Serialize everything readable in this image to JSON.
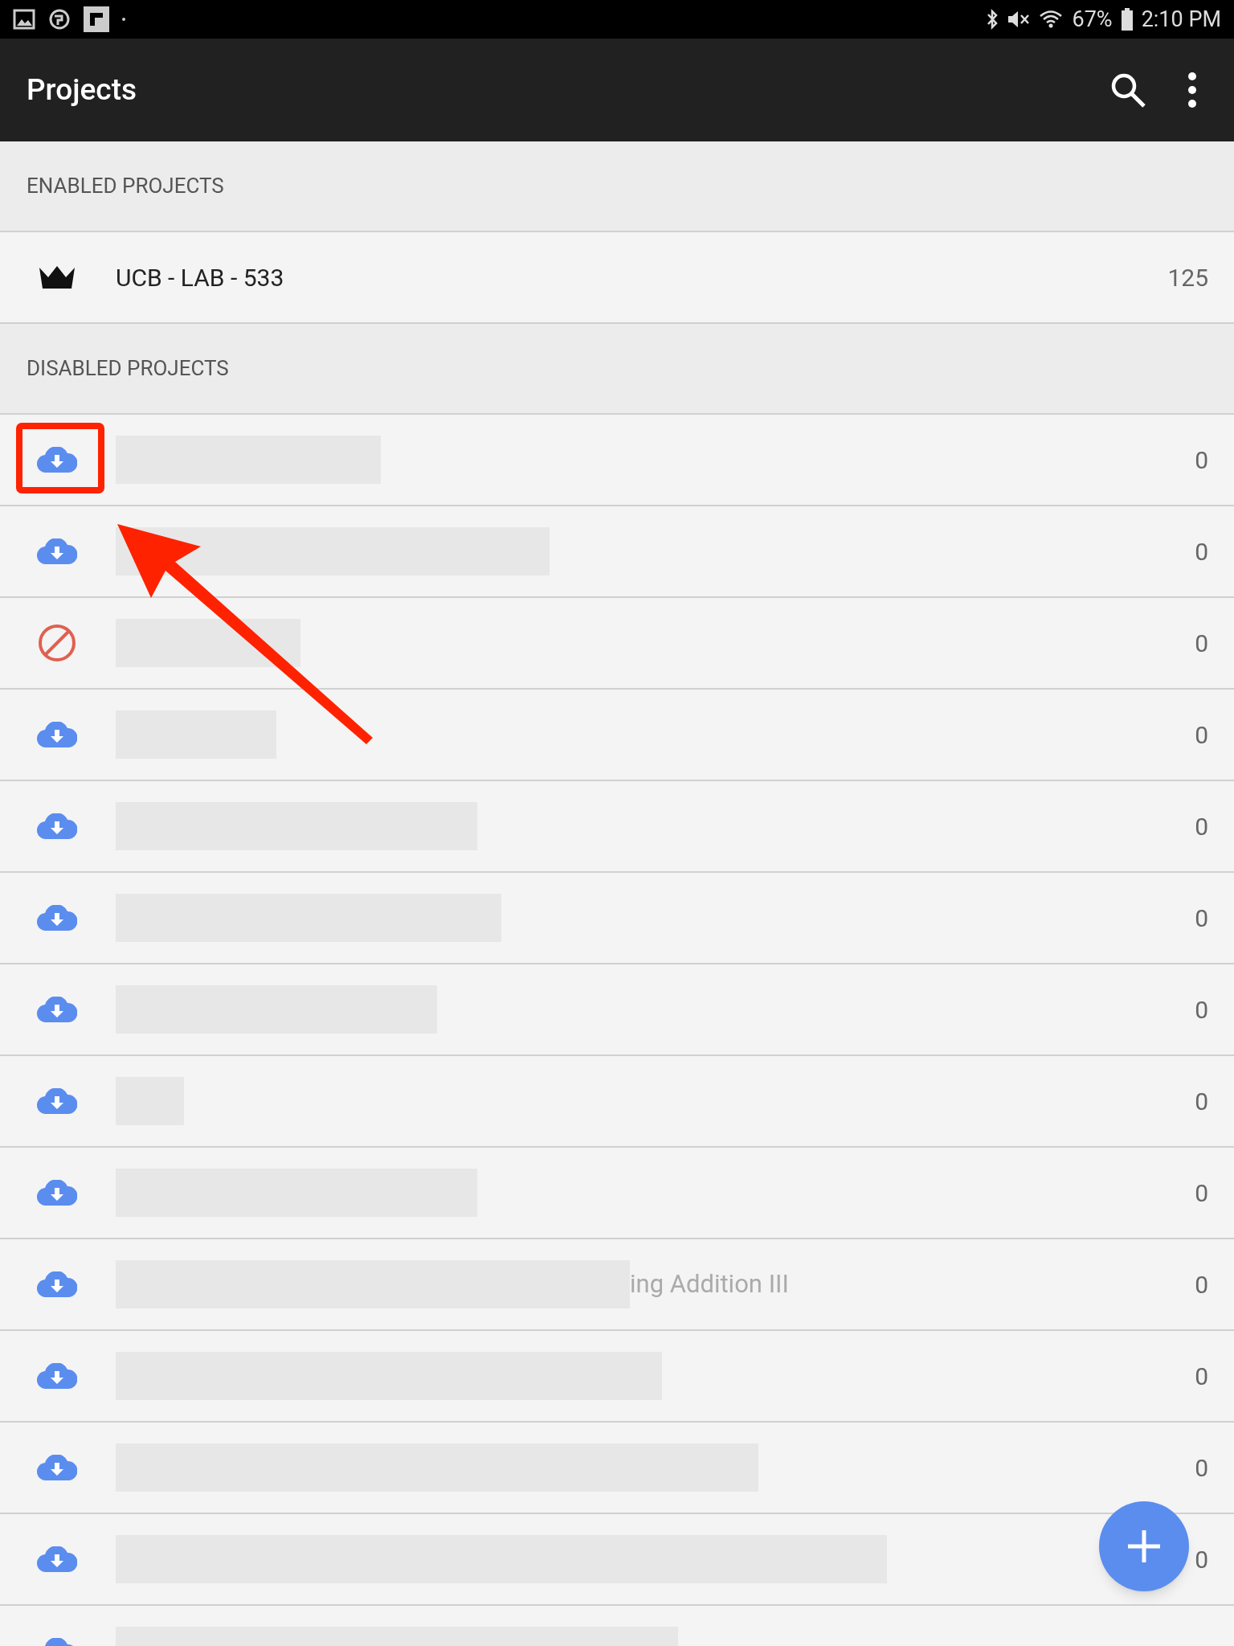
{
  "status_bar": {
    "battery": "67%",
    "time": "2:10 PM"
  },
  "app_bar": {
    "title": "Projects"
  },
  "sections": [
    {
      "header": "ENABLED PROJECTS",
      "rows": [
        {
          "kind": "crown",
          "name": "UCB - LAB - 533",
          "count": "125"
        }
      ]
    },
    {
      "header": "DISABLED PROJECTS",
      "rows": [
        {
          "kind": "download",
          "count": "0"
        },
        {
          "kind": "download",
          "count": "0"
        },
        {
          "kind": "blocked",
          "count": "0"
        },
        {
          "kind": "download",
          "count": "0"
        },
        {
          "kind": "download",
          "count": "0"
        },
        {
          "kind": "download",
          "count": "0"
        },
        {
          "kind": "download",
          "count": "0"
        },
        {
          "kind": "download",
          "count": "0"
        },
        {
          "kind": "download",
          "count": "0"
        },
        {
          "kind": "download",
          "name": "ing Addition III",
          "count": "0"
        },
        {
          "kind": "download",
          "count": "0"
        },
        {
          "kind": "download",
          "count": "0"
        },
        {
          "kind": "download",
          "count": "0"
        },
        {
          "kind": "download"
        }
      ]
    }
  ]
}
